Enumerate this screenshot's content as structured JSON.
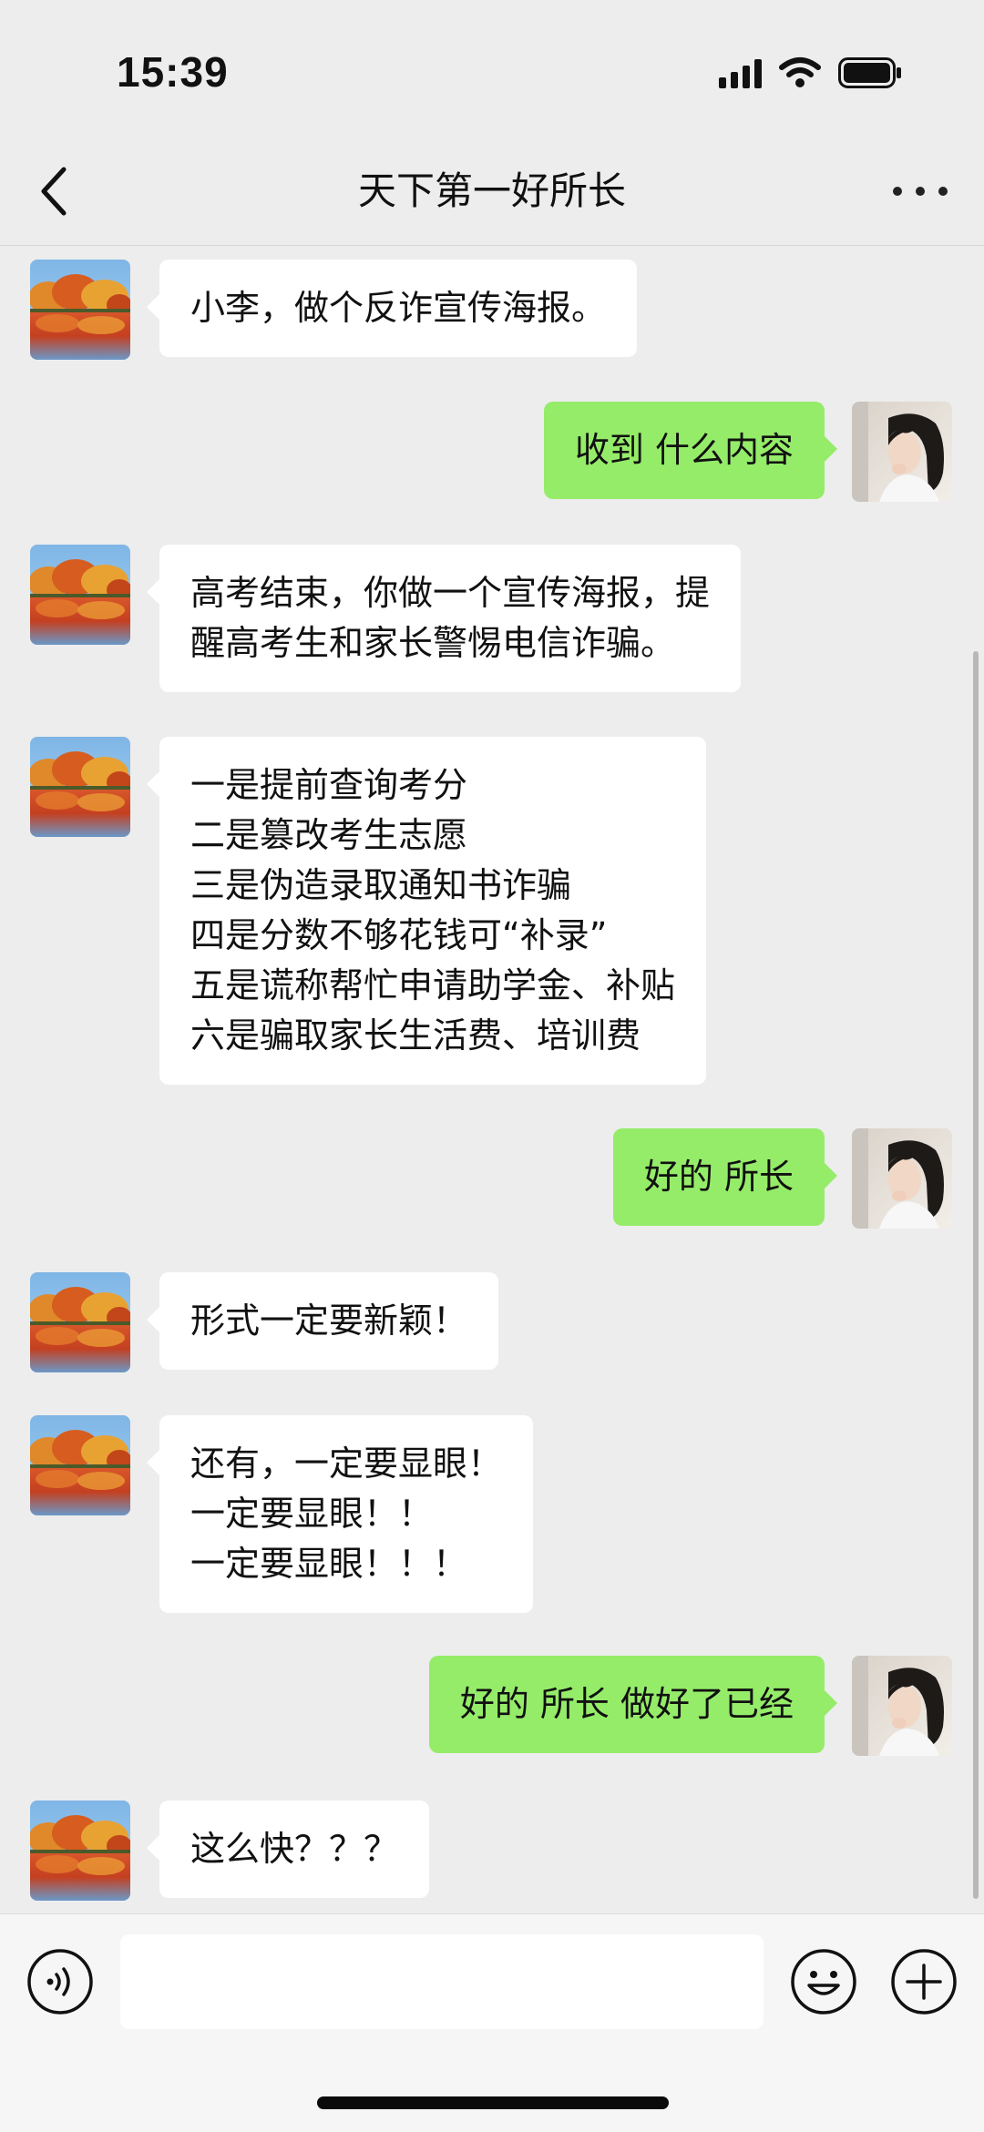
{
  "status_bar": {
    "time": "15:39"
  },
  "header": {
    "title": "天下第一好所长",
    "back_icon": "chevron-left-icon",
    "more_icon": "more-dots-icon"
  },
  "colors": {
    "background": "#ededed",
    "incoming_bubble": "#ffffff",
    "outgoing_bubble": "#95ec69"
  },
  "messages": [
    {
      "side": "left",
      "text": "小李，做个反诈宣传海报。"
    },
    {
      "side": "right",
      "text": "收到 什么内容"
    },
    {
      "side": "left",
      "text": "高考结束，你做一个宣传海报，提\n醒高考生和家长警惕电信诈骗。"
    },
    {
      "side": "left",
      "text": "一是提前查询考分\n二是篡改考生志愿\n三是伪造录取通知书诈骗\n四是分数不够花钱可“补录”\n五是谎称帮忙申请助学金、补贴\n六是骗取家长生活费、培训费"
    },
    {
      "side": "right",
      "text": "好的 所长"
    },
    {
      "side": "left",
      "text": "形式一定要新颖！"
    },
    {
      "side": "left",
      "text": "还有，一定要显眼！\n一定要显眼！！\n一定要显眼！！！"
    },
    {
      "side": "right",
      "text": "好的 所长 做好了已经"
    },
    {
      "side": "left",
      "text": "这么快？？？"
    }
  ],
  "input_bar": {
    "voice_icon": "voice-icon",
    "input_value": "",
    "emoji_icon": "emoji-icon",
    "plus_icon": "plus-icon"
  }
}
